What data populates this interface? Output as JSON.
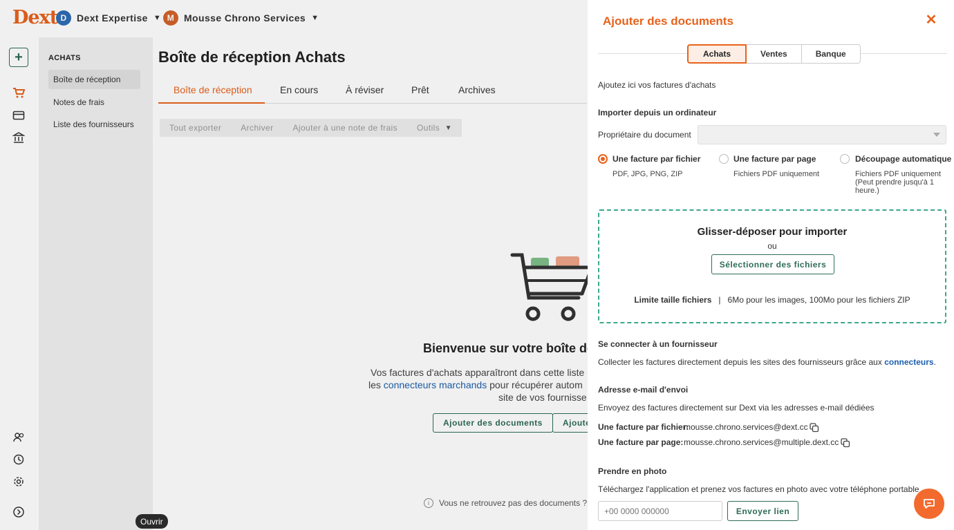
{
  "app": {
    "logo": "Dext",
    "account": {
      "initial": "D",
      "name": "Dext Expertise",
      "color": "#2f6db5"
    },
    "client": {
      "initial": "M",
      "name": "Mousse Chrono Services",
      "color": "#d4622a"
    }
  },
  "subnav": {
    "header": "ACHATS",
    "items": [
      {
        "label": "Boîte de réception"
      },
      {
        "label": "Notes de frais"
      },
      {
        "label": "Liste des fournisseurs"
      }
    ]
  },
  "main": {
    "title": "Boîte de réception Achats",
    "tabs": [
      {
        "label": "Boîte de réception"
      },
      {
        "label": "En cours"
      },
      {
        "label": "À réviser"
      },
      {
        "label": "Prêt"
      },
      {
        "label": "Archives"
      }
    ],
    "toolbar": [
      "Tout exporter",
      "Archiver",
      "Ajouter à une note de frais",
      "Outils"
    ],
    "welcome": "Bienvenue sur votre boîte de r",
    "para_l1": "Vos factures d'achats apparaîtront dans cette liste",
    "para_l2_link": "connecteurs marchands",
    "para_l2_pre": "les ",
    "para_l2_post": " pour récupérer autom",
    "para_l3": "site de vos fournisse",
    "btn_add": "Ajouter des documents",
    "btn_add2": "Ajoute",
    "foot_note": "Vous ne retrouvez pas des documents ? V",
    "tooltip": "Ouvrir"
  },
  "drawer": {
    "title": "Ajouter des documents",
    "tabs": [
      {
        "label": "Achats"
      },
      {
        "label": "Ventes"
      },
      {
        "label": "Banque"
      }
    ],
    "intro": "Ajoutez ici vos factures d'achats",
    "import_title": "Importer depuis un ordinateur",
    "owner_label": "Propriétaire du document",
    "options": [
      {
        "label": "Une facture par fichier",
        "desc": "PDF, JPG, PNG, ZIP",
        "selected": true
      },
      {
        "label": "Une facture par page",
        "desc": "Fichiers PDF uniquement",
        "selected": false
      },
      {
        "label": "Découpage automatique",
        "desc1": "Fichiers PDF uniquement",
        "desc2": "(Peut prendre jusqu'à 1",
        "desc3": "heure.)",
        "selected": false
      }
    ],
    "drop": {
      "title": "Glisser-déposer pour importer",
      "or": "ou",
      "select_btn": "Sélectionner des fichiers",
      "limit_label": "Limite taille fichiers",
      "limit_sep": "|",
      "limit_value": "6Mo pour les images, 100Mo pour les fichiers ZIP"
    },
    "connect_title": "Se connecter à un fournisseur",
    "connect_text": "Collecter les factures directement depuis les sites des fournisseurs grâce aux ",
    "connect_link": "connecteurs",
    "connect_end": ".",
    "email_title": "Adresse e-mail d'envoi",
    "email_text": "Envoyez des factures directement sur Dext via les adresses e-mail dédiées",
    "email_file_label": "Une facture par fichier:",
    "email_file_value": "mousse.chrono.services@dext.cc",
    "email_page_label": "Une facture par page:",
    "email_page_value": "mousse.chrono.services@multiple.dext.cc",
    "photo_title": "Prendre en photo",
    "photo_text": "Téléchargez l'application et prenez vos factures en photo avec votre téléphone portable",
    "phone_placeholder": "+00 0000 000000",
    "send_btn": "Envoyer lien"
  },
  "colors": {
    "accent": "#e8621c",
    "primary_green": "#2e6b57",
    "link": "#1c5fae",
    "dropzone": "#3aa68a"
  }
}
